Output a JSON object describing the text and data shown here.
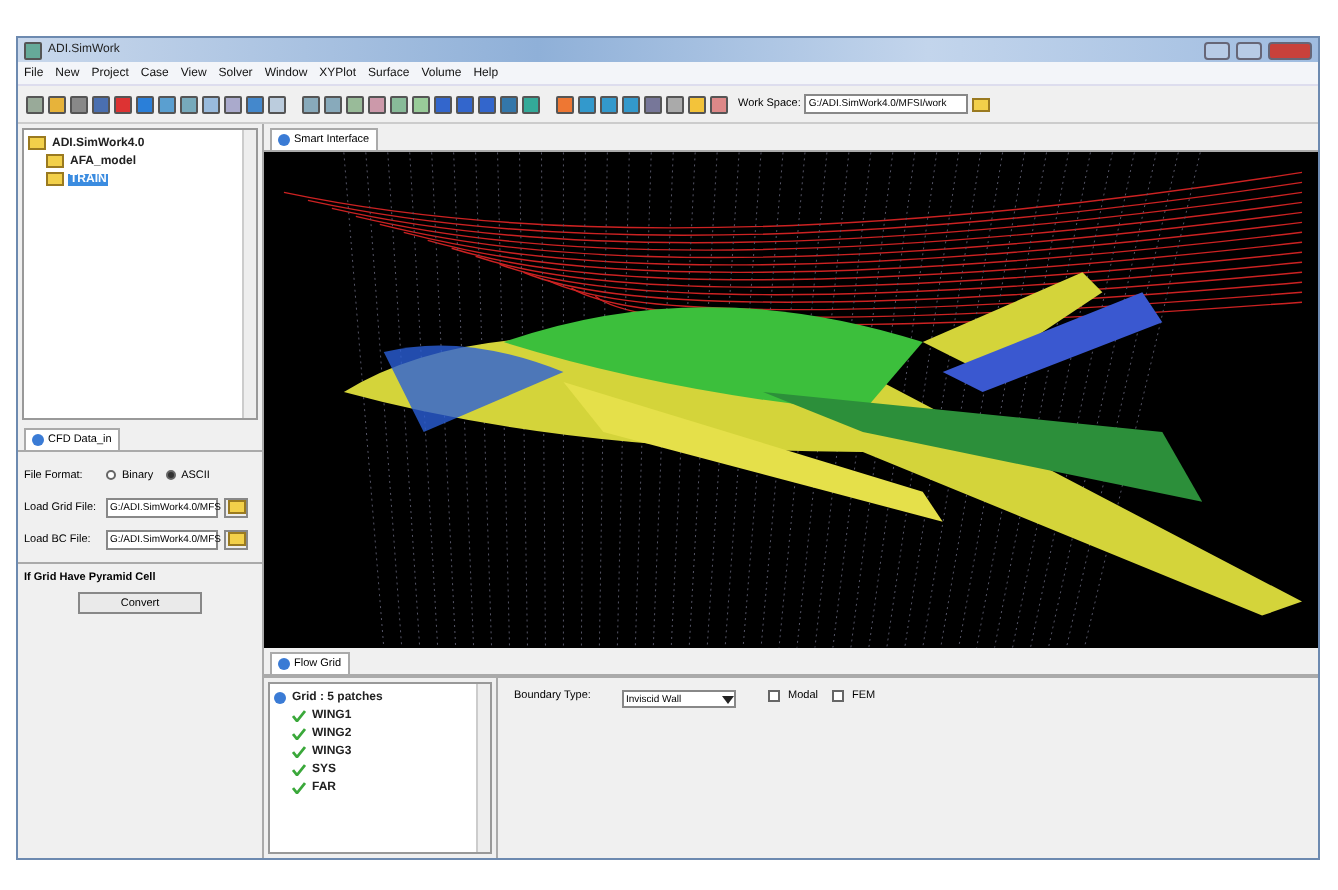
{
  "window": {
    "title": "ADI.SimWork"
  },
  "menu": [
    "File",
    "New",
    "Project",
    "Case",
    "View",
    "Solver",
    "Window",
    "XYPlot",
    "Surface",
    "Volume",
    "Help"
  ],
  "workspace": {
    "label": "Work Space:",
    "value": "G:/ADI.SimWork4.0/MFSI/work"
  },
  "project_tree": [
    {
      "label": "ADI.SimWork4.0",
      "selected": false,
      "children": [
        {
          "label": "AFA_model",
          "selected": false
        },
        {
          "label": "TRAIN",
          "selected": true
        }
      ]
    }
  ],
  "cfd_panel": {
    "tab": "CFD Data_in",
    "format_label": "File Format:",
    "formats": [
      {
        "label": "Binary",
        "selected": false
      },
      {
        "label": "ASCII",
        "selected": true
      }
    ],
    "fields": [
      {
        "label": "Load Grid File:",
        "value": "G:/ADI.SimWork4.0/MFS"
      },
      {
        "label": "Load BC File:",
        "value": "G:/ADI.SimWork4.0/MFS"
      }
    ],
    "section": "If Grid Have Pyramid Cell",
    "button": "Convert"
  },
  "viewport": {
    "tab": "Smart Interface"
  },
  "flow_grid": {
    "tab": "Flow Grid",
    "root": "Grid : 5 patches",
    "patches": [
      {
        "label": "WING1",
        "checked": true
      },
      {
        "label": "WING2",
        "checked": true
      },
      {
        "label": "WING3",
        "checked": true
      },
      {
        "label": "SYS",
        "checked": true
      },
      {
        "label": "FAR",
        "checked": true
      }
    ],
    "boundary_label": "Boundary Type:",
    "boundary_value": "Inviscid Wall",
    "options": [
      {
        "label": "Modal",
        "checked": false
      },
      {
        "label": "FEM",
        "checked": false
      }
    ]
  }
}
